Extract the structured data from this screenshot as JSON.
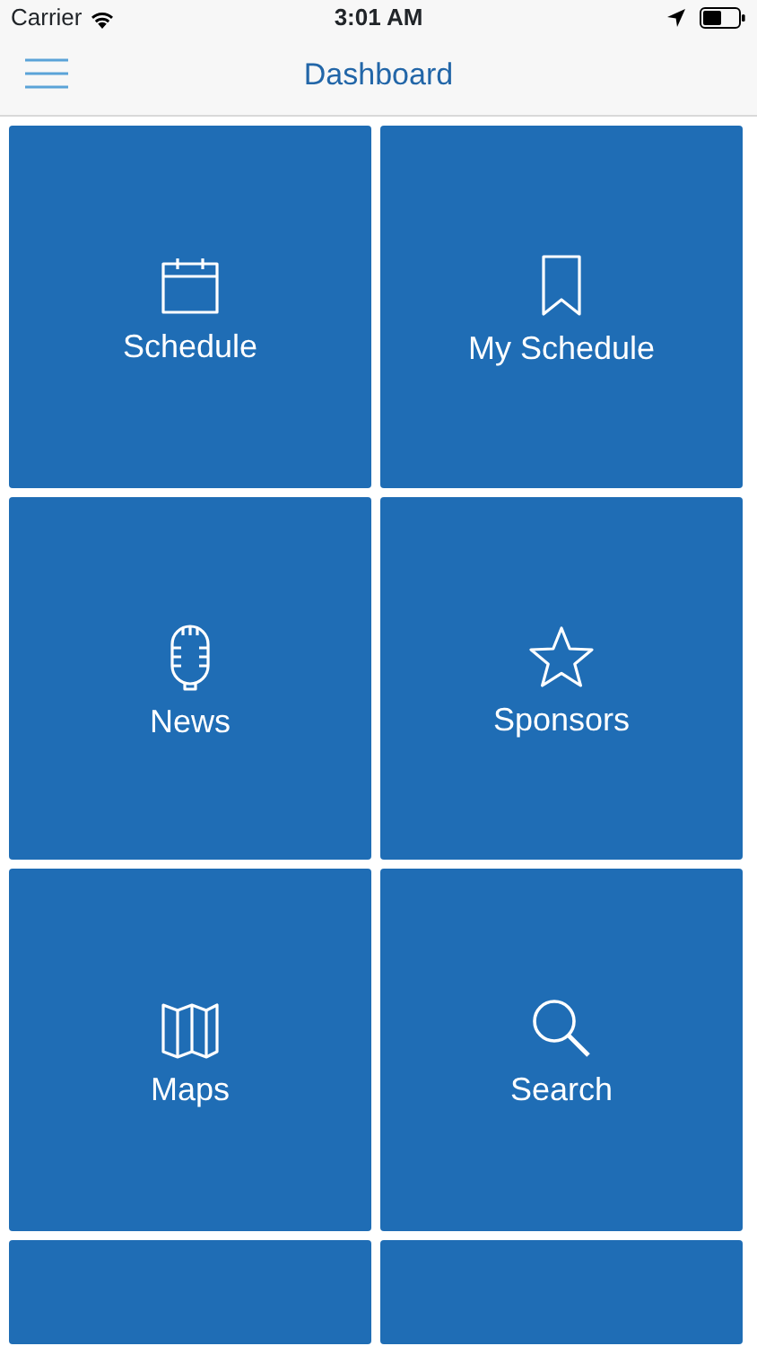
{
  "status_bar": {
    "carrier": "Carrier",
    "time": "3:01 AM"
  },
  "nav_bar": {
    "title": "Dashboard"
  },
  "tiles": [
    {
      "kind": "tile",
      "label": "Schedule"
    },
    {
      "kind": "tile",
      "label": "My Schedule"
    },
    {
      "kind": "tile",
      "label": "News"
    },
    {
      "kind": "tile",
      "label": "Sponsors"
    },
    {
      "kind": "tile",
      "label": "Maps"
    },
    {
      "kind": "tile",
      "label": "Search"
    },
    {
      "kind": "cut-off"
    },
    {
      "kind": "cut-off"
    }
  ]
}
